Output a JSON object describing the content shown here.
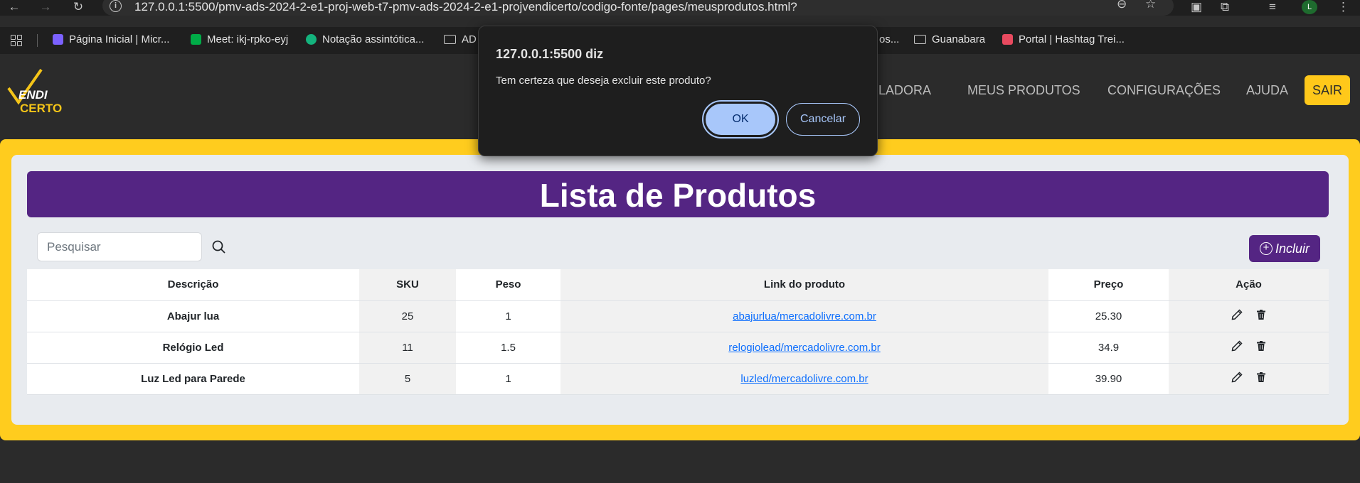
{
  "browser": {
    "url": "127.0.0.1:5500/pmv-ads-2024-2-e1-proj-web-t7-pmv-ads-2024-2-e1-projvendicerto/codigo-fonte/pages/meusprodutos.html?",
    "profile_initial": "L",
    "bookmarks": [
      {
        "label": "Página Inicial | Micr...",
        "color": "#7b61ff"
      },
      {
        "label": "Meet: ikj-rpko-eyj",
        "color": "#00ac47"
      },
      {
        "label": "Notação assintótica...",
        "color": "#14b37d"
      },
      {
        "label": "AD",
        "folder": true
      },
      {
        "label": "os...",
        "folder": false
      },
      {
        "label": "Guanabara",
        "folder": true
      },
      {
        "label": "Portal | Hashtag Trei...",
        "color": "#e84a5f"
      }
    ]
  },
  "site": {
    "logo_line1": "ENDI",
    "logo_line2": "CERTO",
    "nav": [
      "ULADORA",
      "MEUS PRODUTOS",
      "CONFIGURAÇÕES",
      "AJUDA"
    ],
    "logout_label": "SAIR",
    "brand_yellow": "#ffcc1e",
    "brand_purple": "#542583"
  },
  "products_page": {
    "title": "Lista de Produtos",
    "search_placeholder": "Pesquisar",
    "add_label": "Incluir",
    "columns": [
      "Descrição",
      "SKU",
      "Peso",
      "Link do produto",
      "Preço",
      "Ação"
    ],
    "rows": [
      {
        "descricao": "Abajur lua",
        "sku": "25",
        "peso": "1",
        "link": "abajurlua/mercadolivre.com.br",
        "preco": "25.30"
      },
      {
        "descricao": "Relógio Led",
        "sku": "11",
        "peso": "1.5",
        "link": "relogiolead/mercadolivre.com.br",
        "preco": "34.9"
      },
      {
        "descricao": "Luz Led para Parede",
        "sku": "5",
        "peso": "1",
        "link": "luzled/mercadolivre.com.br",
        "preco": "39.90"
      }
    ]
  },
  "dialog": {
    "origin": "127.0.0.1:5500 diz",
    "message": "Tem certeza que deseja excluir este produto?",
    "ok_label": "OK",
    "cancel_label": "Cancelar"
  }
}
